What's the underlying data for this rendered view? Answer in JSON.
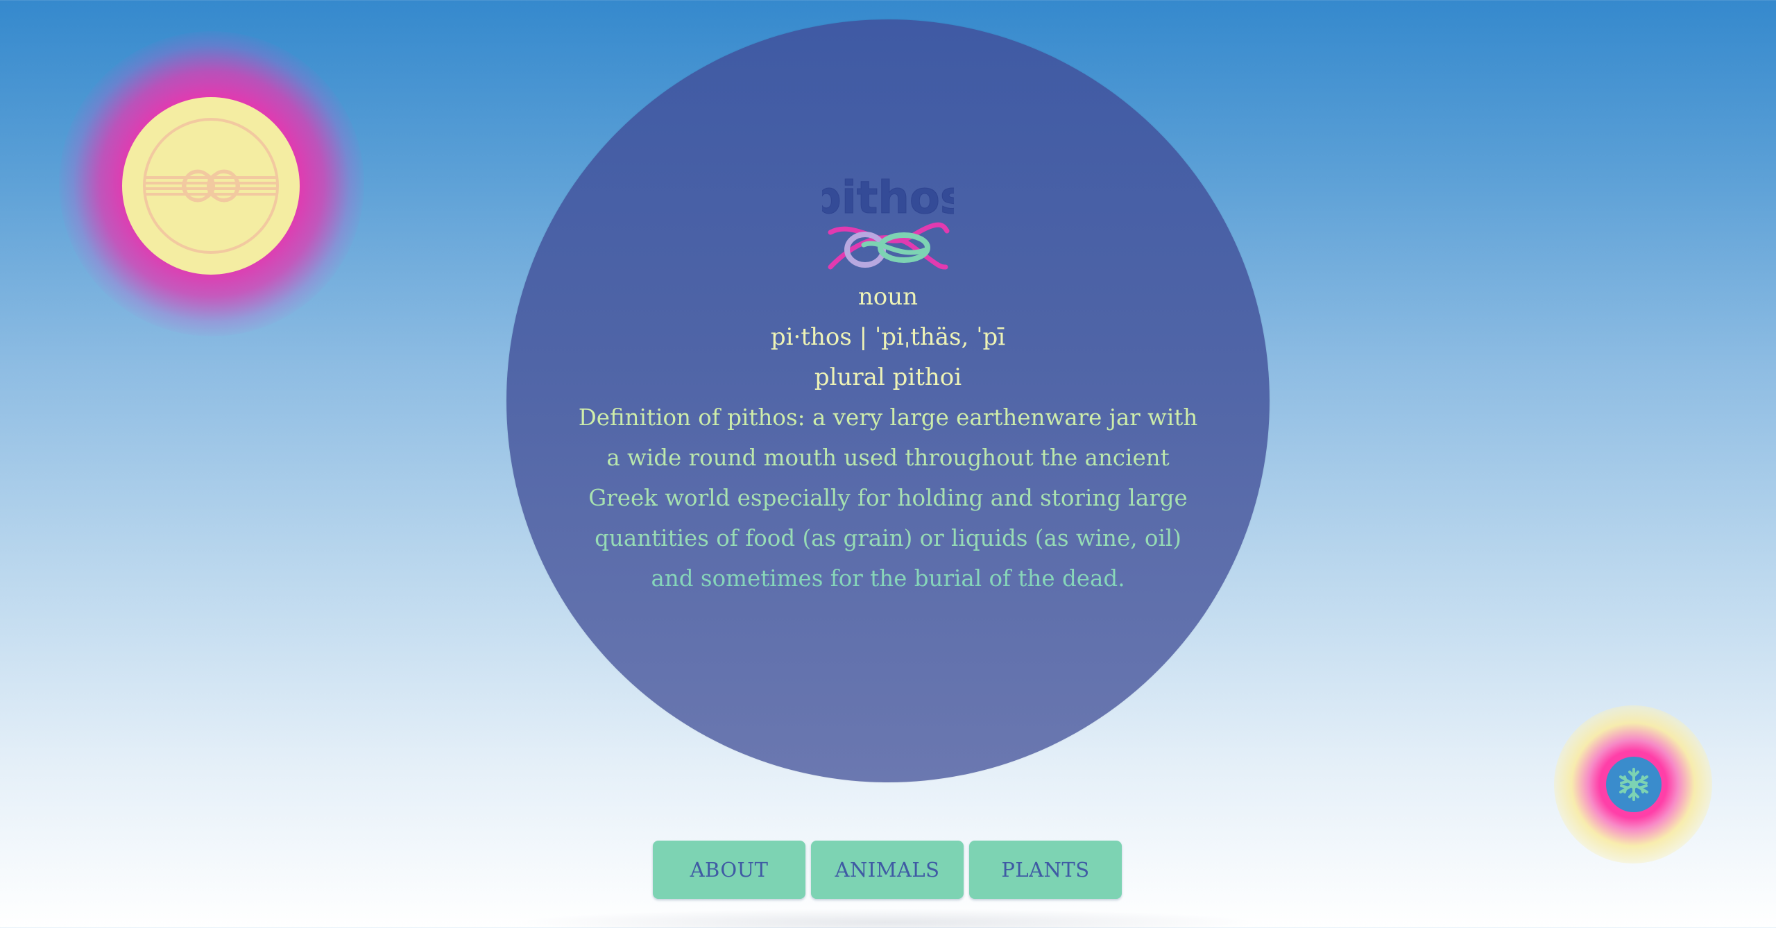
{
  "brand": {
    "wordmark": "pithos",
    "icon": "knot-icon"
  },
  "entry": {
    "part_of_speech": "noun",
    "pronunciation": "pi·thos | ˈpiˌthäs, ˈpī",
    "plural": "plural pithoi",
    "definition": "Definition of pithos: a very large earthenware jar with a wide round mouth used throughout the ancient Greek world especially for holding and storing large quantities of food (as grain) or liquids (as wine, oil) and sometimes for the burial of the dead."
  },
  "nav": {
    "about_label": "ABOUT",
    "animals_label": "ANIMALS",
    "plants_label": "PLANTS"
  },
  "decor": {
    "sun_icon": "knot-emblem-icon",
    "flower_icon": "snowflake-icon"
  },
  "colors": {
    "circle": "#4a60a6",
    "button": "#7dd3b3",
    "button_text": "#3f5aa4",
    "accent_pink": "#e23ab0",
    "sun_yellow": "#f4eda2",
    "text_light": "#eef3b6"
  }
}
